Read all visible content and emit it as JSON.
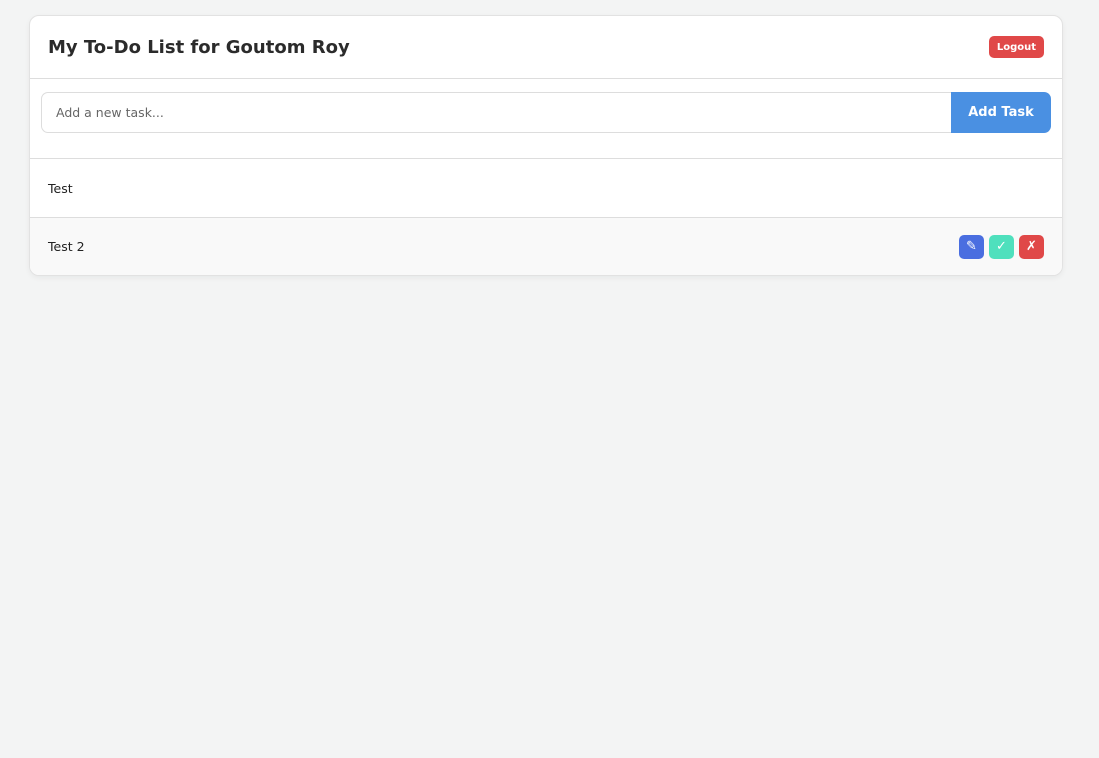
{
  "header": {
    "title": "My To-Do List for Goutom Roy",
    "logout_label": "Logout"
  },
  "add": {
    "placeholder": "Add a new task...",
    "value": "",
    "button_label": "Add Task"
  },
  "tasks": [
    {
      "text": "Test"
    },
    {
      "text": "Test 2"
    }
  ],
  "actions": {
    "edit_icon": "✎",
    "complete_icon": "✓",
    "delete_icon": "✗"
  },
  "colors": {
    "edit": "#4a6ee0",
    "complete": "#4fe0bd",
    "delete": "#e04848",
    "accent": "#4a90e2"
  }
}
